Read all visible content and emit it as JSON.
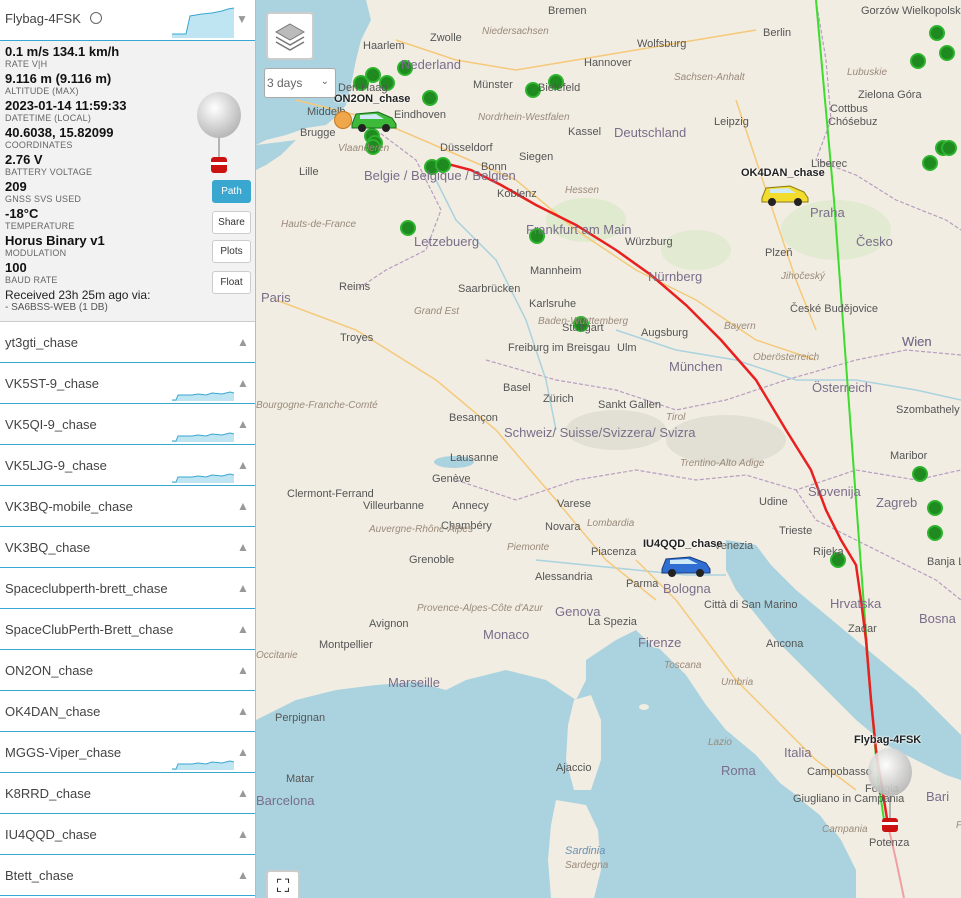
{
  "current_vehicle": {
    "name": "Flybag-4FSK",
    "icon": "crosshair-icon",
    "rate": "0.1 m/s 134.1 km/h",
    "rate_label": "RATE V|H",
    "altitude": "9.116 m (9.116 m)",
    "altitude_label": "ALTITUDE (MAX)",
    "datetime": "2023-01-14 11:59:33",
    "datetime_label": "DATETIME (LOCAL)",
    "coordinates": "40.6038, 15.82099",
    "coordinates_label": "COORDINATES",
    "battery": "2.76 V",
    "battery_label": "BATTERY VOLTAGE",
    "svs": "209",
    "svs_label": "GNSS SVS USED",
    "temperature": "-18°C",
    "temperature_label": "TEMPERATURE",
    "modulation": "Horus Binary v1",
    "modulation_label": "MODULATION",
    "baud": "100",
    "baud_label": "BAUD RATE",
    "received": "Received 23h 25m ago via:",
    "received_via": "- SA6BSS-WEB (1 DB)"
  },
  "buttons": {
    "path": "Path",
    "share": "Share",
    "plots": "Plots",
    "float": "Float"
  },
  "vehicle_list": [
    "yt3gti_chase",
    "VK5ST-9_chase",
    "VK5QI-9_chase",
    "VK5LJG-9_chase",
    "VK3BQ-mobile_chase",
    "VK3BQ_chase",
    "Spaceclubperth-brett_chase",
    "SpaceClubPerth-Brett_chase",
    "ON2ON_chase",
    "OK4DAN_chase",
    "MGGS-Viper_chase",
    "K8RRD_chase",
    "IU4QQD_chase",
    "Btett_chase"
  ],
  "map": {
    "range_select": "3 days",
    "callouts": {
      "on2on": "ON2ON_chase",
      "ok4dan": "OK4DAN_chase",
      "iu4qqd": "IU4QQD_chase",
      "flybag": "Flybag-4FSK"
    },
    "cities": [
      "Bremen",
      "Berlin",
      "Gorzów Wielkopolski",
      "Haarlem",
      "Zwolle",
      "Wolfsburg",
      "Hannover",
      "Nederland",
      "Münster",
      "Bielefeld",
      "Den Haag",
      "Eindhoven",
      "Middelb",
      "Brugge",
      "Düsseldorf",
      "Kassel",
      "Deutschland",
      "Leipzig",
      "Cottbus",
      "Chóśebuz",
      "Zielona Góra",
      "Liberec",
      "Lille",
      "Belgie / Belgique / Belgien",
      "Bonn",
      "Siegen",
      "Koblenz",
      "Praha",
      "Frankfurt am Main",
      "Würzburg",
      "Letzebuerg",
      "Česko",
      "Plzeň",
      "Mannheim",
      "Nürnberg",
      "Paris",
      "Reims",
      "Saarbrücken",
      "Karlsruhe",
      "České Budějovice",
      "Troyes",
      "Stuttgart",
      "Augsburg",
      "Ulm",
      "Freiburg im Breisgau",
      "München",
      "Wien",
      "Basel",
      "Zürich",
      "Österreich",
      "Sankt Gallen",
      "Szombathely",
      "Besançon",
      "Schweiz/ Suisse/Svizzera/ Svizra",
      "Lausanne",
      "Genève",
      "Maribor",
      "Clermont-Ferrand",
      "Villeurbanne",
      "Annecy",
      "Slovenija",
      "Zagreb",
      "Udine",
      "Trieste",
      "Chambéry",
      "Varese",
      "Novara",
      "Venezia",
      "Rijeka",
      "Grenoble",
      "Piacenza",
      "Alessandria",
      "Bologna",
      "Parma",
      "Genova",
      "Città di San Marino",
      "Hrvatska",
      "Avignon",
      "Monaco",
      "Firenze",
      "La Spezia",
      "Ancona",
      "Montpellier",
      "Marseille",
      "Zadar",
      "Perpignan",
      "Italia",
      "Roma",
      "Campobasso",
      "Ajaccio",
      "Bari",
      "Giugliano in Campania",
      "Matar",
      "Barcelona",
      "Potenza",
      "Foggia",
      "Bosna",
      "Banja L",
      "Wien"
    ],
    "regions": [
      "Niedersachsen",
      "Sachsen-Anhalt",
      "Nordrhein-Westfalen",
      "Hessen",
      "Vlaanderen",
      "Bayern",
      "Jihočeský",
      "Hauts-de-France",
      "Grand Est",
      "Baden-Württemberg",
      "Oberösterreich",
      "Bourgogne-Franche-Comté",
      "Tirol",
      "Trentino-Alto Adige",
      "Auvergne-Rhône-Alpes",
      "Lombardia",
      "Piemonte",
      "Provence-Alpes-Côte d'Azur",
      "Toscana",
      "Umbria",
      "Occitanie",
      "Sardegna",
      "Lubuskie",
      "Lazio",
      "Campania",
      "Puglia"
    ],
    "seas": [
      "Sardinia"
    ]
  },
  "colors": {
    "accent": "#3aa7d0",
    "path": "#e8201f",
    "prediction": "#3ddc2e",
    "chase_dot": "#1f8a1f"
  }
}
